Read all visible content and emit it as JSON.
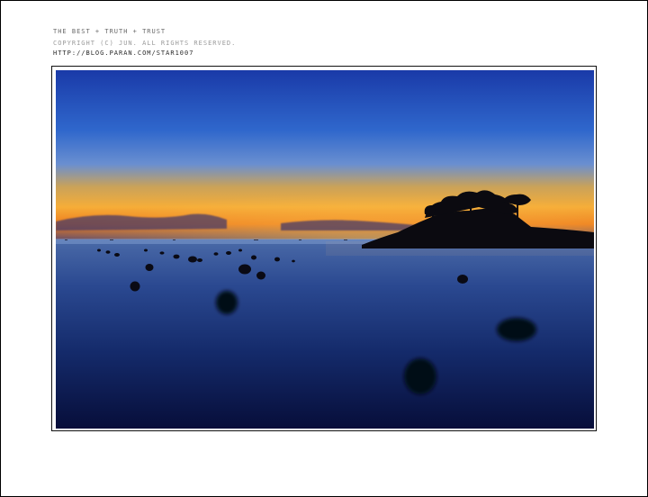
{
  "captions": {
    "line1": "the best + truth + trust",
    "line2": "copyright (c) jun. all rights reserved.",
    "line3": "http://blog.paran.com/star1007"
  },
  "photo": {
    "subject": "sunset-seascape-with-island",
    "colors": {
      "sky_top": "#1a3fb0",
      "sky_mid": "#3a78d8",
      "horizon_orange": "#f08a20",
      "horizon_gold": "#f6b53a",
      "water_top": "#3a5a9a",
      "water_bottom": "#0a1240",
      "silhouette": "#0b0a10"
    }
  }
}
